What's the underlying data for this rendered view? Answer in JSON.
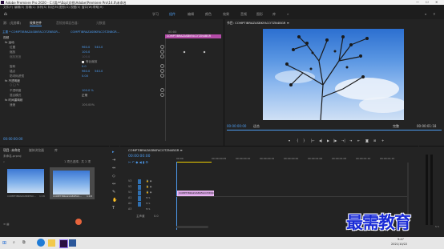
{
  "window": {
    "title": "Adobe Premiere Pro 2020 - C:\\用户\\Eqc\\文档\\Adobe\\Premiere Pro\\14.0\\未命名",
    "controls": [
      "—",
      "☐",
      "✕"
    ]
  },
  "menu": [
    "文件(F)",
    "编辑(E)",
    "剪辑(C)",
    "序列(S)",
    "标记(M)",
    "图形(G)",
    "视图(V)",
    "窗口(W)",
    "帮助(H)"
  ],
  "workspaces": {
    "items": [
      "学习",
      "组件",
      "编辑",
      "颜色",
      "效果",
      "音频",
      "图形",
      "库",
      "»"
    ],
    "active_index": 1
  },
  "effect_controls": {
    "tabs": [
      "源：(无剪辑)",
      "效果控件",
      "音频剪辑混合器：",
      "元数据"
    ],
    "master_label": "主要 * COMPTIBRAZASBKFACOTZNBGR...",
    "clip_label": "COMPTIBRAZASBKFACOTZNBGR...",
    "timecode_small": "00:00",
    "clip_bar_label": "COMPTIBRAZASBKFACOTZN4BGR",
    "sections": [
      {
        "label": "视频",
        "indent": 0
      },
      {
        "label": "fx 运动",
        "indent": 1
      },
      {
        "label": "位置",
        "indent": 2,
        "v1": "960.0",
        "v2": "540.0"
      },
      {
        "label": "缩放",
        "indent": 2,
        "v1": "100.0"
      },
      {
        "label": "缩放宽度",
        "indent": 2,
        "v1": "100.0"
      },
      {
        "label": "等比缩放",
        "indent": 3,
        "checkbox": true
      },
      {
        "label": "旋转",
        "indent": 2,
        "v1": "0.0"
      },
      {
        "label": "锚点",
        "indent": 2,
        "v1": "960.0",
        "v2": "540.0"
      },
      {
        "label": "防闪烁滤镜",
        "indent": 2,
        "v1": "0.00"
      },
      {
        "label": "fx 不透明度",
        "indent": 1
      },
      {
        "label": "不透明度",
        "indent": 2,
        "v1": "100.0 %"
      },
      {
        "label": "混合模式",
        "indent": 2,
        "v1": "正常"
      },
      {
        "label": "fx 时间重映射",
        "indent": 1
      },
      {
        "label": "速度",
        "indent": 2,
        "v1": "100.00%"
      }
    ],
    "bottom_timecode": "00:00:00:00"
  },
  "program_monitor": {
    "title": "节目: COMPTIBRAZASBKFACOTZN4BGR ≡",
    "timecode": "00:00:00:00",
    "fit": "适合",
    "quality": "完整",
    "duration": "00:00:01:18",
    "controls": [
      "▾",
      "{",
      "}",
      "|←",
      "◀|",
      "▶",
      "|▶",
      "→|",
      "⇥",
      "⇤",
      "📷",
      "⊞",
      "+"
    ]
  },
  "project": {
    "tabs": [
      "项目: 未命名",
      "媒体浏览器",
      "库"
    ],
    "filename": "未命名.prproj",
    "item_count": "1 项已选择，共 2 项",
    "items": [
      {
        "name": "COMPTIBRAZASBKFAC...",
        "duration": "1:18"
      },
      {
        "name": "COMPTIBRAZASBKFAC...",
        "duration": "1:18"
      }
    ]
  },
  "timeline": {
    "tab": "COMPTIBRAZASBKFACOTZN4BGR ≡",
    "timecode": "00:00:00:00",
    "ruler": [
      "00:00",
      "00:00:00:05",
      "00:00:00:10",
      "00:00:00:15",
      "00:00:00:20",
      "00:00:01:00",
      "00:00:01:05",
      "00:00:01:10",
      "00:00:01:15"
    ],
    "tracks_video": [
      "V3",
      "V2",
      "V1"
    ],
    "tracks_audio": [
      "A1",
      "A2",
      "A3"
    ],
    "master": "主声道",
    "master_val": "0.0",
    "clip_label": "COMPTIBRAZASBKFACOTZN4BGR"
  },
  "taskbar": {
    "time": "9:47",
    "date": "2021/10/22",
    "watermark": "最需教育"
  }
}
